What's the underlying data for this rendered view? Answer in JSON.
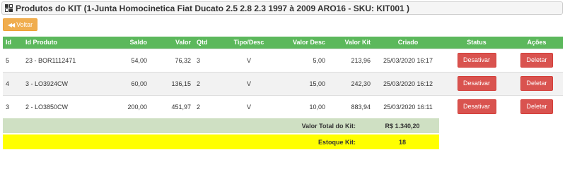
{
  "header": {
    "title": "Produtos do KIT (1-Junta Homocinetica Fiat Ducato 2.5 2.8 2.3 1997 à 2009 ARO16 - SKU: KIT001 )"
  },
  "toolbar": {
    "back_label": "Voltar"
  },
  "table": {
    "columns": [
      "Id",
      "Id Produto",
      "Saldo",
      "Valor",
      "Qtd",
      "Tipo/Desc",
      "Valor Desc",
      "Valor Kit",
      "Criado",
      "Status",
      "Ações"
    ],
    "rows": [
      {
        "id": "5",
        "produto": "23 - BOR1112471",
        "saldo": "54,00",
        "valor": "76,32",
        "qtd": "3",
        "tipo": "V",
        "valor_desc": "5,00",
        "valor_kit": "213,96",
        "criado": "25/03/2020 16:17",
        "status_label": "Desativar",
        "acao_label": "Deletar"
      },
      {
        "id": "4",
        "produto": "3 - LO3924CW",
        "saldo": "60,00",
        "valor": "136,15",
        "qtd": "2",
        "tipo": "V",
        "valor_desc": "15,00",
        "valor_kit": "242,30",
        "criado": "25/03/2020 16:12",
        "status_label": "Desativar",
        "acao_label": "Deletar"
      },
      {
        "id": "3",
        "produto": "2 - LO3850CW",
        "saldo": "200,00",
        "valor": "451,97",
        "qtd": "2",
        "tipo": "V",
        "valor_desc": "10,00",
        "valor_kit": "883,94",
        "criado": "25/03/2020 16:11",
        "status_label": "Desativar",
        "acao_label": "Deletar"
      }
    ]
  },
  "summary": {
    "total_label": "Valor Total do Kit:",
    "total_value": "R$ 1.340,20",
    "estoque_label": "Estoque Kit:",
    "estoque_value": "18"
  },
  "colors": {
    "header_green": "#5cb85c",
    "voltar_orange": "#f0ad4e",
    "danger_red": "#d9534f",
    "total_bg": "#cfe0c3",
    "estoque_bg": "#ffff00"
  }
}
